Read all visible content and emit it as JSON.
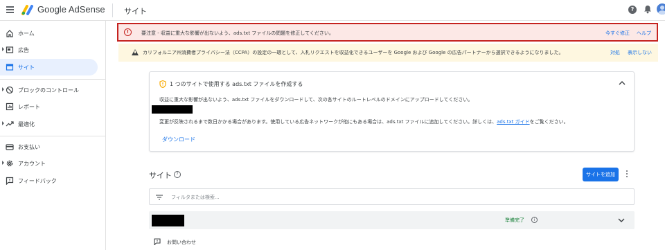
{
  "topbar": {
    "brand": "Google AdSense",
    "page_title": "サイト",
    "help_label": "?"
  },
  "sidebar": {
    "items": [
      {
        "label": "ホーム",
        "icon": "home-icon"
      },
      {
        "label": "広告",
        "icon": "ads-icon"
      },
      {
        "label": "サイト",
        "icon": "sites-icon"
      },
      {
        "label": "ブロックのコントロール",
        "icon": "block-icon"
      },
      {
        "label": "レポート",
        "icon": "report-icon"
      },
      {
        "label": "最適化",
        "icon": "trending-icon"
      },
      {
        "label": "お支払い",
        "icon": "payments-icon"
      },
      {
        "label": "アカウント",
        "icon": "gear-icon"
      },
      {
        "label": "フィードバック",
        "icon": "feedback-icon"
      }
    ]
  },
  "alerts": {
    "red": {
      "text": "要注意 - 収益に重大な影響が出ないよう、ads.txt ファイルの問題を修正してください。",
      "fix_now": "今すぐ修正",
      "help": "ヘルプ",
      "color": "#c5221f"
    },
    "yellow": {
      "text": "カリフォルニア州消費者プライバシー法（CCPA）の設定の一環として、入札リクエストを収益化できるユーザーを Google および Google の広告パートナーから選択できるようになりました。",
      "action": "対処",
      "dismiss": "表示しない"
    }
  },
  "card": {
    "title": "1 つのサイトで使用する ads.txt ファイルを作成する",
    "description": "収益に重大な影響が出ないよう、ads.txt ファイルをダウンロードして、次の各サイトのルートレベルのドメインにアップロードしてください。",
    "note_prefix": "変更が反映されるまで数日かかる場合があります。使用している広告ネットワークが他にもある場合は、ads.txt ファイルに追加してください。詳しくは、",
    "note_link": "ads.txt ガイド",
    "note_suffix": "をご覧ください。",
    "download": "ダウンロード"
  },
  "sites": {
    "title": "サイト",
    "help_label": "?",
    "add_button": "サイトを追加",
    "filter_placeholder": "フィルタまたは検索...",
    "rows": [
      {
        "status": "準備完了",
        "info_label": "i"
      }
    ]
  },
  "contact": "お問い合わせ",
  "colors": {
    "accent": "#1a73e8",
    "active_nav_bg": "#e8f0fe",
    "error": "#c5221f",
    "warning_bg": "#fef7e0",
    "success": "#188038"
  }
}
